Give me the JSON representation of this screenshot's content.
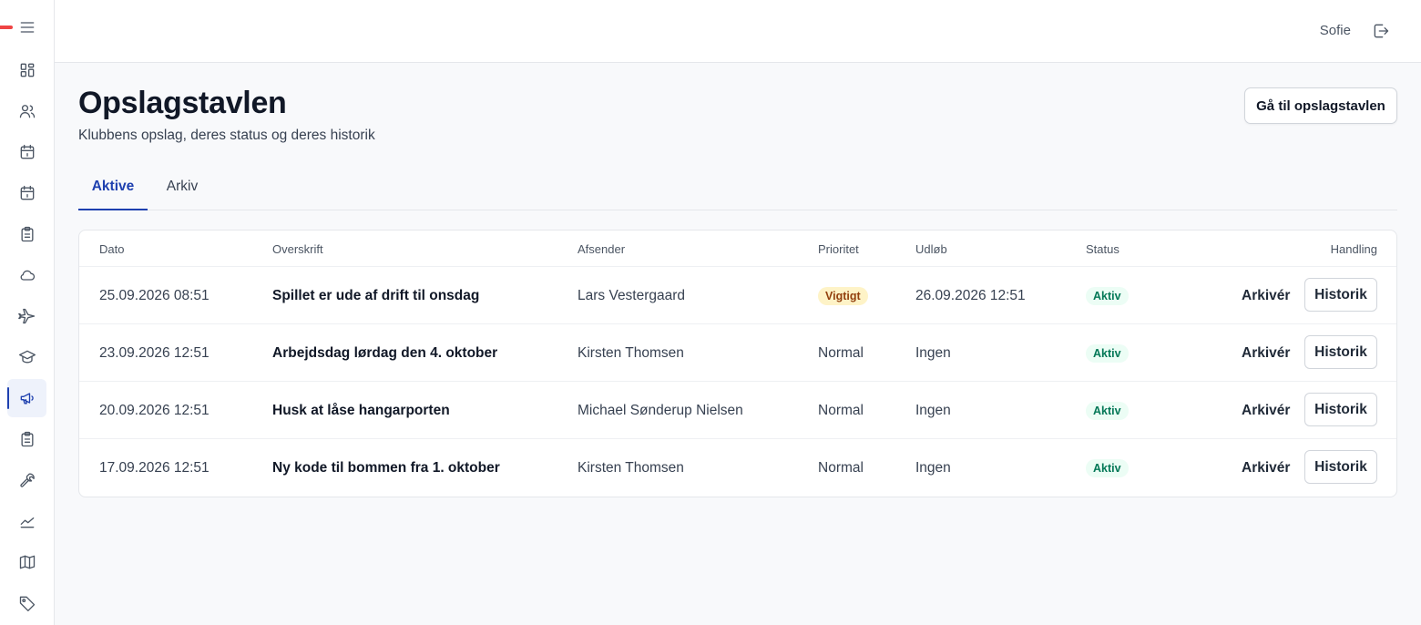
{
  "user": {
    "name": "Sofie"
  },
  "icons": {
    "menu": "menu-icon",
    "logout": "logout-icon"
  },
  "sidebar": {
    "items": [
      {
        "icon": "dashboard-icon",
        "active": false
      },
      {
        "icon": "users-icon",
        "active": false
      },
      {
        "icon": "calendar-icon",
        "active": false
      },
      {
        "icon": "calendar-alt-icon",
        "active": false
      },
      {
        "icon": "clipboard-icon",
        "active": false
      },
      {
        "icon": "cloud-icon",
        "active": false
      },
      {
        "icon": "plane-icon",
        "active": false
      },
      {
        "icon": "graduation-cap-icon",
        "active": false
      },
      {
        "icon": "megaphone-icon",
        "active": true
      },
      {
        "icon": "clipboard-list-icon",
        "active": false
      },
      {
        "icon": "wrench-icon",
        "active": false
      },
      {
        "icon": "chart-icon",
        "active": false
      },
      {
        "icon": "map-icon",
        "active": false
      },
      {
        "icon": "tag-icon",
        "active": false
      }
    ]
  },
  "header": {
    "title": "Opslagstavlen",
    "subtitle": "Klubbens opslag, deres status og deres historik",
    "goto_button": "Gå til opslagstavlen"
  },
  "tabs": [
    {
      "label": "Aktive",
      "active": true
    },
    {
      "label": "Arkiv",
      "active": false
    }
  ],
  "table": {
    "columns": {
      "date": "Dato",
      "title": "Overskrift",
      "sender": "Afsender",
      "priority": "Prioritet",
      "expiry": "Udløb",
      "status": "Status",
      "action": "Handling"
    },
    "rows": [
      {
        "date": "25.09.2026 08:51",
        "title": "Spillet er ude af drift til onsdag",
        "sender": "Lars Vestergaard",
        "priority": "Vigtigt",
        "priority_highlight": true,
        "expiry": "26.09.2026 12:51",
        "status": "Aktiv",
        "archive": "Arkivér",
        "history": "Historik"
      },
      {
        "date": "23.09.2026 12:51",
        "title": "Arbejdsdag lørdag den 4. oktober",
        "sender": "Kirsten Thomsen",
        "priority": "Normal",
        "priority_highlight": false,
        "expiry": "Ingen",
        "status": "Aktiv",
        "archive": "Arkivér",
        "history": "Historik"
      },
      {
        "date": "20.09.2026 12:51",
        "title": "Husk at låse hangarporten",
        "sender": "Michael Sønderup Nielsen",
        "priority": "Normal",
        "priority_highlight": false,
        "expiry": "Ingen",
        "status": "Aktiv",
        "archive": "Arkivér",
        "history": "Historik"
      },
      {
        "date": "17.09.2026 12:51",
        "title": "Ny kode til bommen fra 1. oktober",
        "sender": "Kirsten Thomsen",
        "priority": "Normal",
        "priority_highlight": false,
        "expiry": "Ingen",
        "status": "Aktiv",
        "archive": "Arkivér",
        "history": "Historik"
      }
    ]
  },
  "colors": {
    "accent": "#1e40af",
    "warning_bg": "#fef3c7",
    "warning_text": "#92400e",
    "status_bg": "#ecfdf5",
    "status_text": "#047857",
    "brand_marker": "#ef4444"
  }
}
